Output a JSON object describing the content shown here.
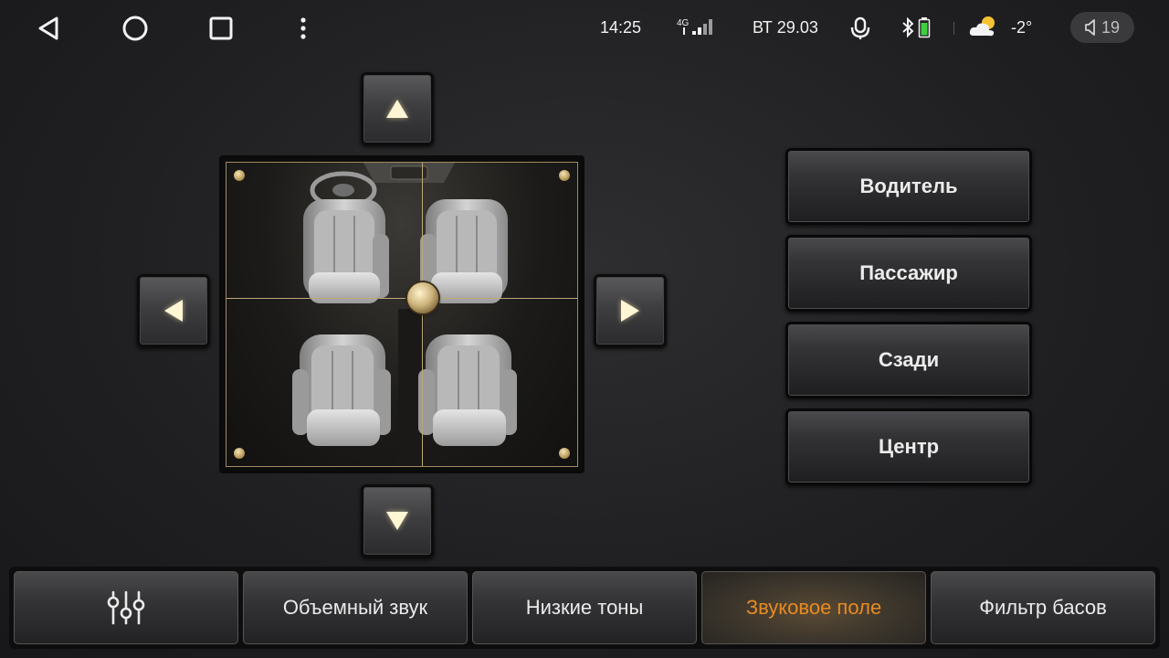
{
  "status_bar": {
    "nav": [
      "back-icon",
      "home-icon",
      "recents-icon",
      "more-icon"
    ],
    "time": "14:25",
    "network": "4G",
    "date": "ВТ 29.03",
    "temperature": "-2°",
    "volume": "19",
    "icons": [
      "signal-icon",
      "microphone-icon",
      "bluetooth-icon",
      "battery-icon",
      "weather-icon",
      "volume-icon"
    ]
  },
  "sound_field": {
    "arrows": [
      "up-arrow-icon",
      "left-arrow-icon",
      "right-arrow-icon",
      "down-arrow-icon"
    ]
  },
  "positions": {
    "driver": "Водитель",
    "passenger": "Пассажир",
    "rear": "Сзади",
    "center": "Центр"
  },
  "tabs": {
    "equalizer_icon": "equalizer-icon",
    "surround": "Объемный звук",
    "bass": "Низкие тоны",
    "sound_field": "Звуковое поле",
    "bass_filter": "Фильтр басов",
    "active": "sound_field"
  },
  "colors": {
    "accent": "#e88a22",
    "gold": "#bda878",
    "background": "#232325"
  }
}
